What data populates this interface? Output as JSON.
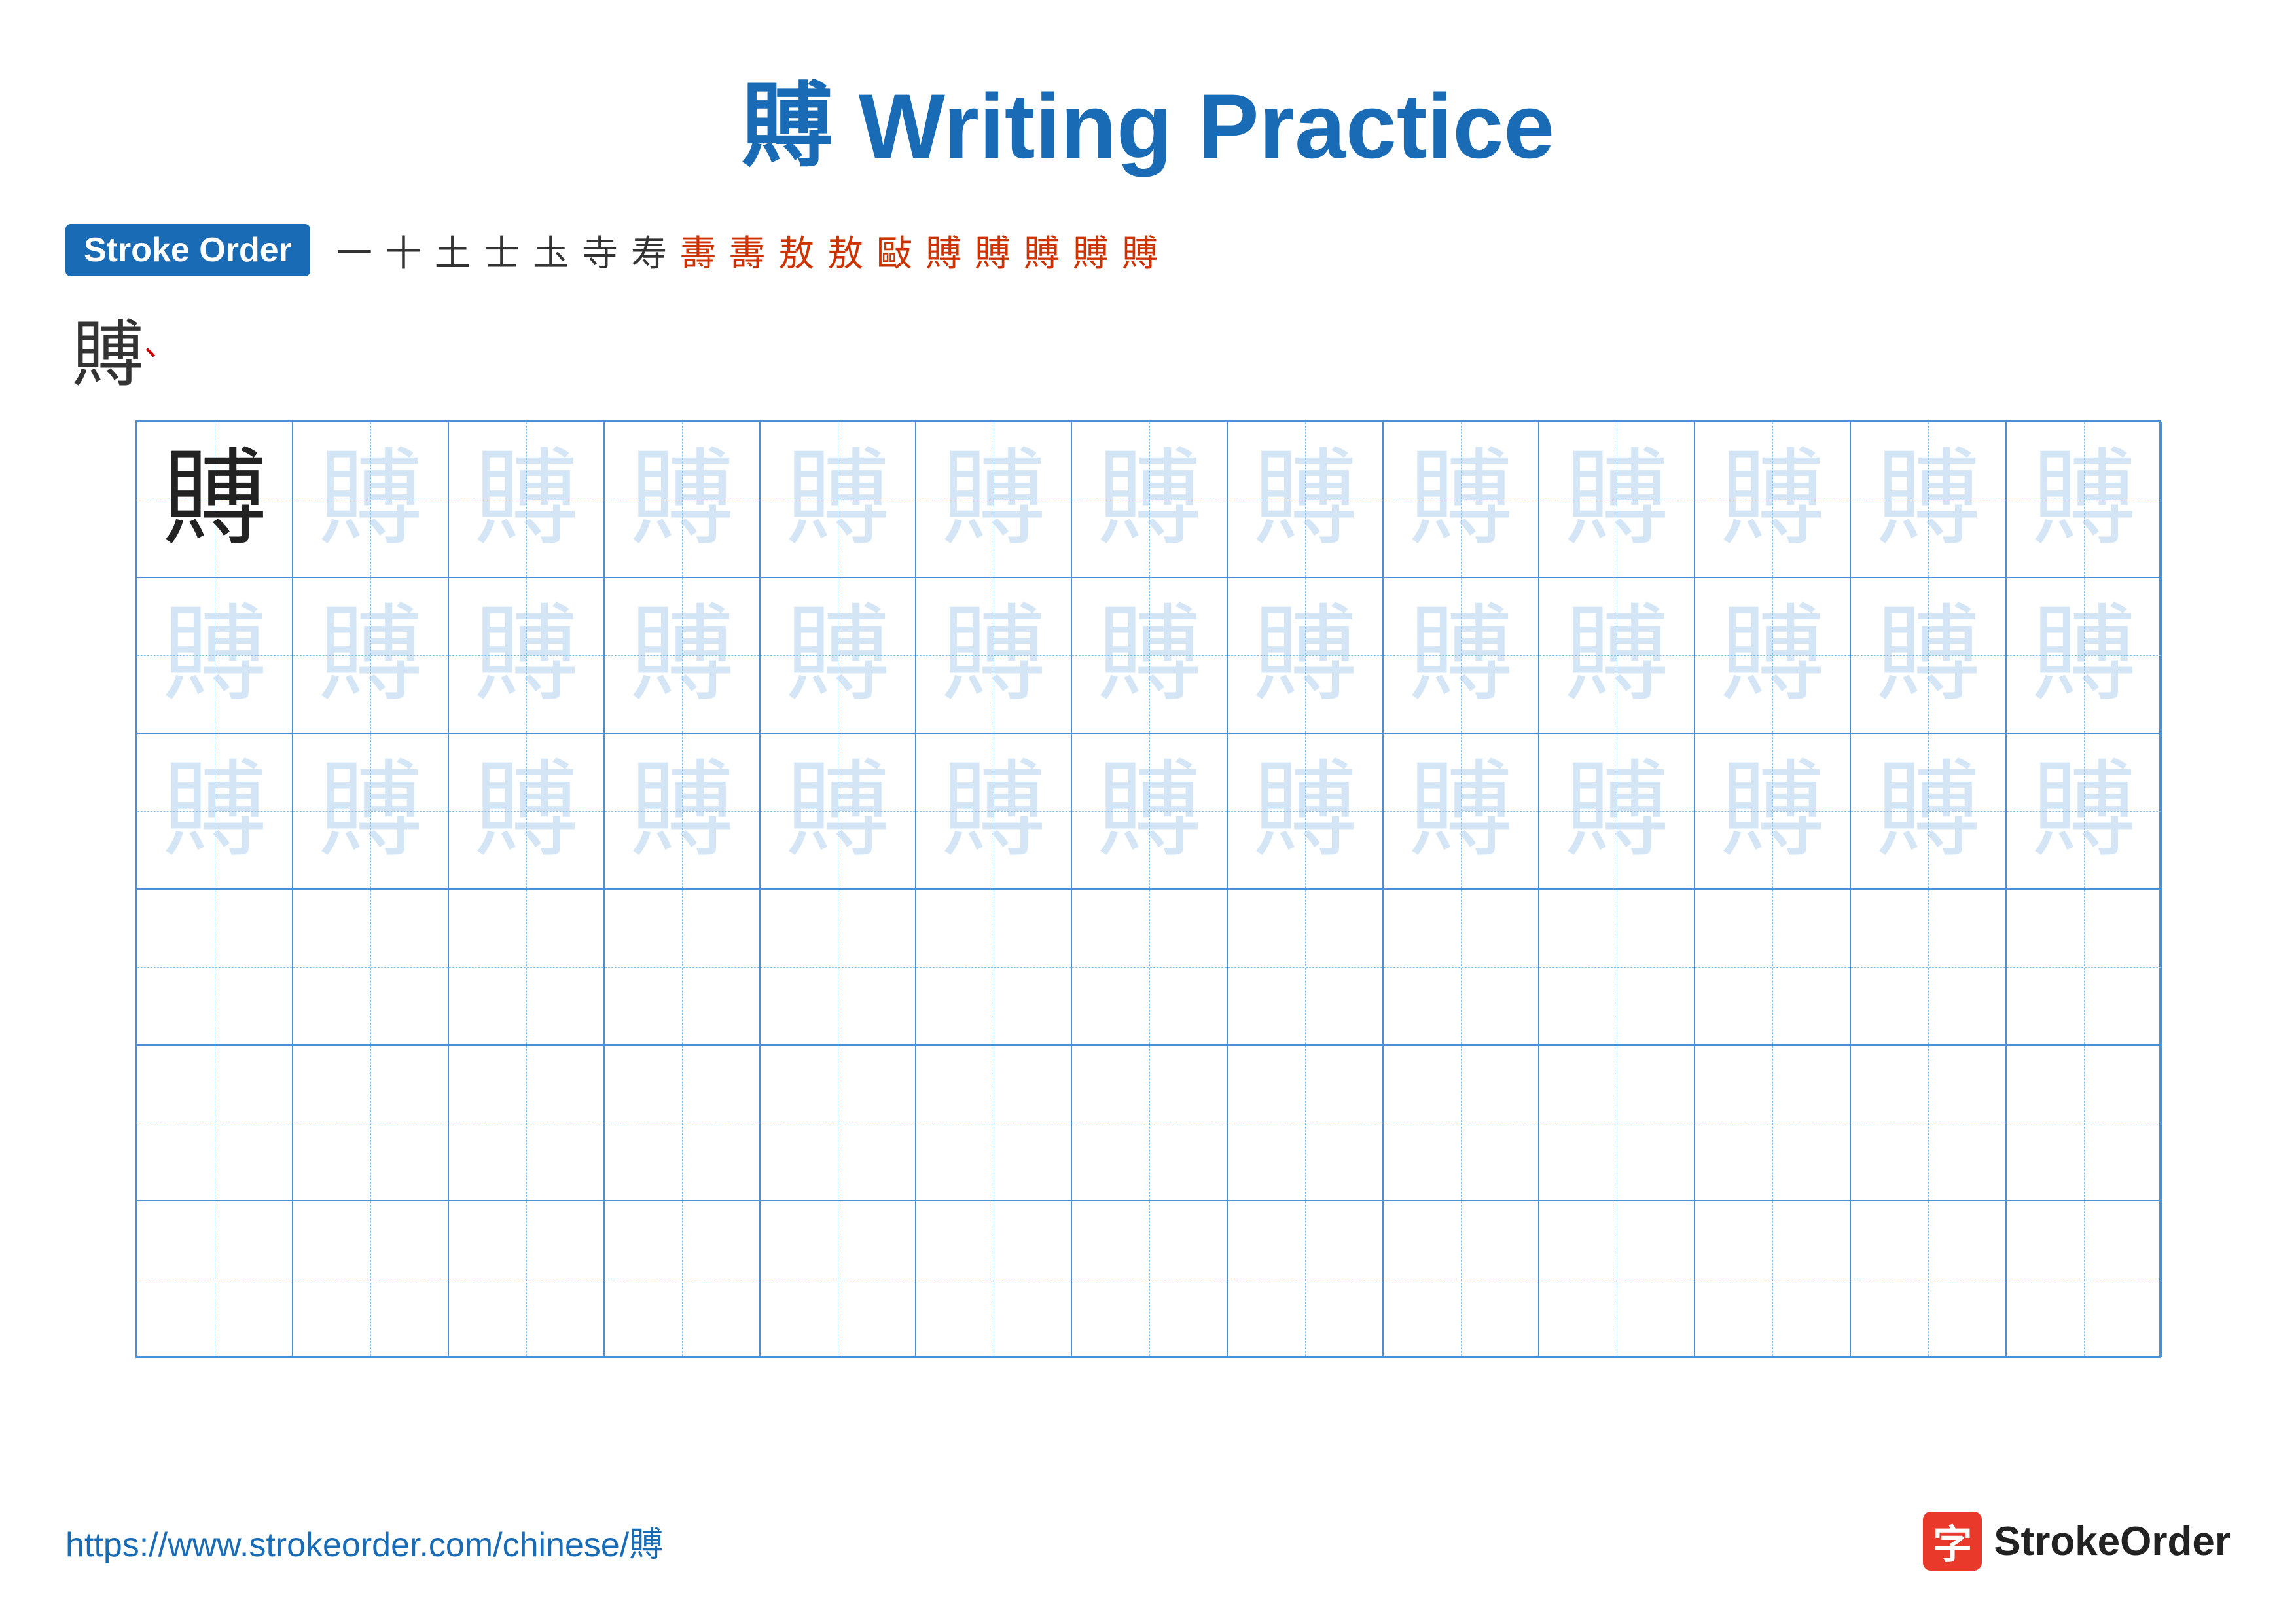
{
  "title": {
    "char": "賻",
    "text": " Writing Practice"
  },
  "stroke_order": {
    "badge": "Stroke Order",
    "steps": [
      "一",
      "十",
      "土",
      "士",
      "圡",
      "寺",
      "寿",
      "夀",
      "夀",
      "夅",
      "敖",
      "敖",
      "敺",
      "敺",
      "賻",
      "賻",
      "賻"
    ],
    "red_indices": [
      13,
      14,
      15,
      16
    ]
  },
  "final_char": "賻",
  "practice_char": "賻",
  "footer": {
    "url": "https://www.strokeorder.com/chinese/賻",
    "logo_char": "字",
    "logo_text": "StrokeOrder"
  },
  "grid": {
    "cols": 13,
    "rows": 6,
    "filled_rows": 3
  }
}
